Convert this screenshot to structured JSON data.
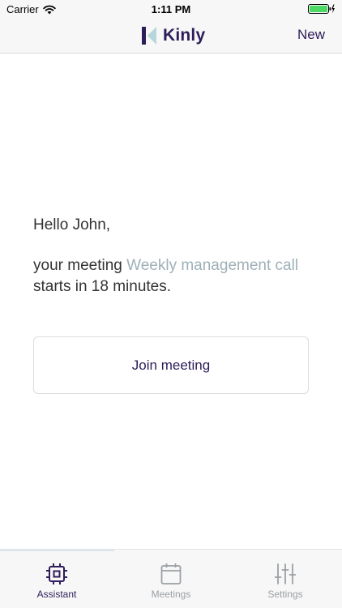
{
  "status_bar": {
    "carrier": "Carrier",
    "time": "1:11 PM"
  },
  "nav": {
    "logo_text": "Kinly",
    "new_label": "New"
  },
  "main": {
    "greeting": "Hello John,",
    "message_prefix": "your meeting ",
    "meeting_name": "Weekly management call",
    "message_suffix": " starts in 18 minutes.",
    "join_label": "Join meeting"
  },
  "tabs": [
    {
      "label": "Assistant",
      "icon": "chip-icon",
      "active": true
    },
    {
      "label": "Meetings",
      "icon": "calendar-icon",
      "active": false
    },
    {
      "label": "Settings",
      "icon": "sliders-icon",
      "active": false
    }
  ],
  "colors": {
    "brand": "#2d1d59",
    "accent_light": "#9fb0b9",
    "battery": "#4cd964",
    "tab_inactive": "#9aa0a4"
  }
}
